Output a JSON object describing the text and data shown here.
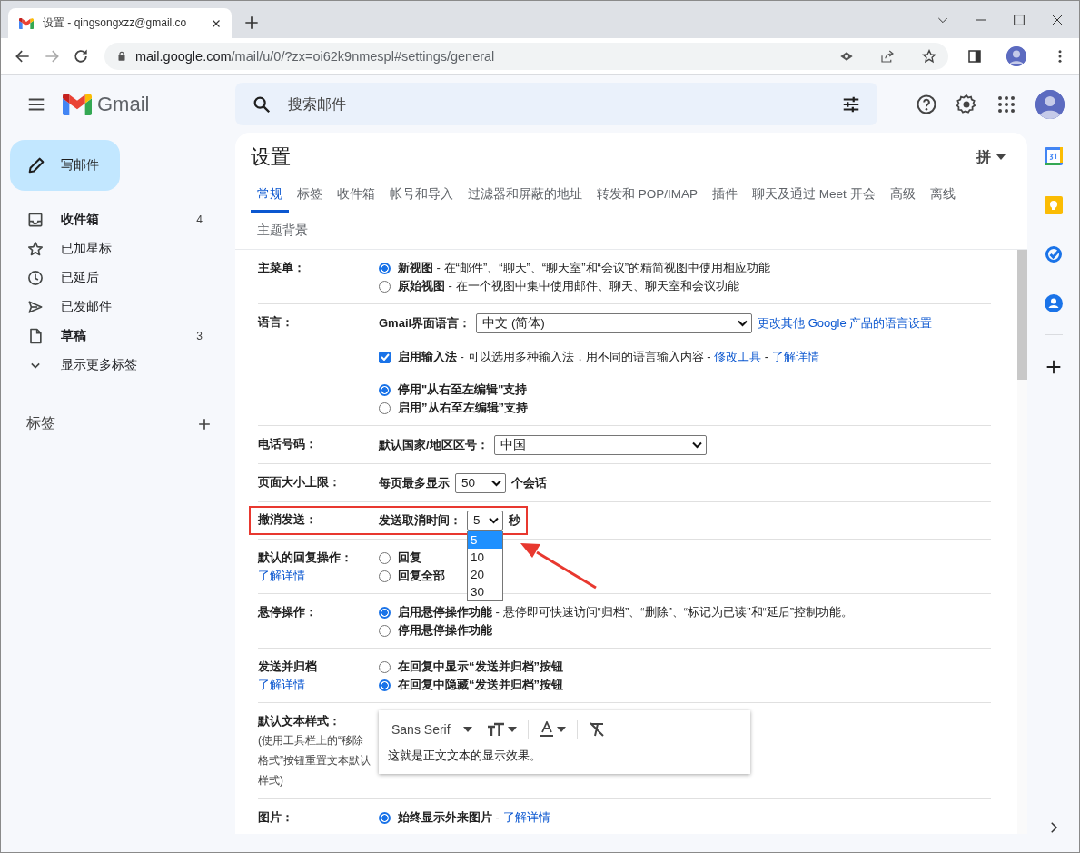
{
  "browser": {
    "tab_title": "设置 - qingsongxzz@gmail.co",
    "url_host": "mail.google.com",
    "url_path": "/mail/u/0/?zx=oi62k9nmespl#settings/general"
  },
  "gmail": {
    "product_name": "Gmail",
    "search_placeholder": "搜索邮件"
  },
  "sidebar": {
    "compose": "写邮件",
    "items": [
      {
        "kind": "inbox",
        "label": "收件箱",
        "count": "4",
        "unread": true
      },
      {
        "kind": "star",
        "label": "已加星标",
        "unread": false
      },
      {
        "kind": "clock",
        "label": "已延后",
        "unread": false
      },
      {
        "kind": "send",
        "label": "已发邮件",
        "unread": false
      },
      {
        "kind": "draft",
        "label": "草稿",
        "count": "3",
        "unread": true
      },
      {
        "kind": "more",
        "label": "显示更多标签",
        "unread": false
      }
    ],
    "labels_heading": "标签"
  },
  "settings": {
    "title": "设置",
    "input_tool": "拼",
    "tabs": [
      {
        "label": "常规",
        "selected": true
      },
      {
        "label": "标签",
        "selected": false
      },
      {
        "label": "收件箱",
        "selected": false
      },
      {
        "label": "帐号和导入",
        "selected": false
      },
      {
        "label": "过滤器和屏蔽的地址",
        "selected": false
      },
      {
        "label": "转发和 POP/IMAP",
        "selected": false
      },
      {
        "label": "插件",
        "selected": false
      },
      {
        "label": "聊天及通过 Meet 开会",
        "selected": false
      },
      {
        "label": "高级",
        "selected": false
      },
      {
        "label": "离线",
        "selected": false
      },
      {
        "label": "主题背景",
        "selected": false
      }
    ],
    "rows": [
      {
        "label": "主菜单：",
        "groups": [
          [
            {
              "kind": "radio",
              "selected": true,
              "parts": [
                {
                  "kind": "text",
                  "text": "**新视图** - 在“邮件”、“聊天”、“聊天室”和“会议”的精简视图中使用相应功能"
                }
              ]
            },
            {
              "kind": "radio",
              "selected": false,
              "parts": [
                {
                  "kind": "text",
                  "text": "**原始视图** - 在一个视图中集中使用邮件、聊天、聊天室和会议功能"
                }
              ]
            }
          ]
        ]
      },
      {
        "label": "语言：",
        "groups": [
          [
            {
              "kind": "select",
              "label": "Gmail界面语言：",
              "value": "中文 (简体)",
              "parts": [
                {
                  "kind": "link",
                  "text": "更改其他 Google 产品的语言设置"
                }
              ]
            }
          ],
          [
            {
              "kind": "checkbox",
              "checked": true,
              "parts": [
                {
                  "kind": "text",
                  "text": "**启用输入法** - 可以选用多种输入法，用不同的语言输入内容 - "
                },
                {
                  "kind": "link",
                  "text": "修改工具"
                },
                {
                  "kind": "text",
                  "text": " - "
                },
                {
                  "kind": "link",
                  "text": "了解详情"
                }
              ]
            }
          ],
          [
            {
              "kind": "radio",
              "selected": true,
              "parts": [
                {
                  "kind": "text",
                  "text": "**停用\"从右至左编辑\"支持**"
                }
              ]
            },
            {
              "kind": "radio",
              "selected": false,
              "parts": [
                {
                  "kind": "text",
                  "text": "**启用”从右至左编辑”支持**"
                }
              ]
            }
          ]
        ]
      },
      {
        "label": "电话号码：",
        "groups": [
          [
            {
              "kind": "select",
              "label": "默认国家/地区区号：",
              "value": "中国"
            }
          ]
        ]
      },
      {
        "label": "页面大小上限：",
        "groups": [
          [
            {
              "kind": "select",
              "label": "每页最多显示",
              "value": "50",
              "suffix": "个会话"
            }
          ]
        ]
      },
      {
        "label": "撤消发送：",
        "highlighted": true,
        "groups": [
          [
            {
              "kind": "select",
              "label": "发送取消时间：",
              "value": "5",
              "suffix": "秒",
              "open": true,
              "options": [
                {
                  "text": "5",
                  "selected": true
                },
                {
                  "text": "10",
                  "selected": false
                },
                {
                  "text": "20",
                  "selected": false
                },
                {
                  "text": "30",
                  "selected": false
                }
              ]
            }
          ]
        ]
      },
      {
        "label": "默认的回复操作：",
        "link": "了解详情",
        "groups": [
          [
            {
              "kind": "radio",
              "selected": false,
              "parts": [
                {
                  "kind": "text",
                  "text": "**回复**"
                }
              ]
            },
            {
              "kind": "radio",
              "selected": false,
              "parts": [
                {
                  "kind": "text",
                  "text": "**回复全部**"
                }
              ]
            }
          ]
        ]
      },
      {
        "label": "悬停操作：",
        "groups": [
          [
            {
              "kind": "radio",
              "selected": true,
              "parts": [
                {
                  "kind": "text",
                  "text": "**启用悬停操作功能** - 悬停即可快速访问“归档”、“删除”、“标记为已读”和“延后”控制功能。"
                }
              ]
            },
            {
              "kind": "radio",
              "selected": false,
              "parts": [
                {
                  "kind": "text",
                  "text": "**停用悬停操作功能**"
                }
              ]
            }
          ]
        ]
      },
      {
        "label": "发送并归档",
        "link": "了解详情",
        "groups": [
          [
            {
              "kind": "radio",
              "selected": false,
              "parts": [
                {
                  "kind": "text",
                  "text": "**在回复中显示“发送并归档”按钮**"
                }
              ]
            },
            {
              "kind": "radio",
              "selected": true,
              "parts": [
                {
                  "kind": "text",
                  "text": "**在回复中隐藏“发送并归档”按钮**"
                }
              ]
            }
          ]
        ]
      },
      {
        "label": "默认文本样式：",
        "note": "(使用工具栏上的“移除格式”按钮重置文本默认样式)",
        "groups": [
          [
            {
              "kind": "editor",
              "font": "Sans Serif",
              "preview": "这就是正文文本的显示效果。"
            }
          ]
        ]
      },
      {
        "label": "图片：",
        "groups": [
          [
            {
              "kind": "radio",
              "selected": true,
              "parts": [
                {
                  "kind": "text",
                  "text": "**始终显示外来图片** - "
                },
                {
                  "kind": "link",
                  "text": "了解详情"
                }
              ]
            }
          ]
        ]
      }
    ]
  }
}
